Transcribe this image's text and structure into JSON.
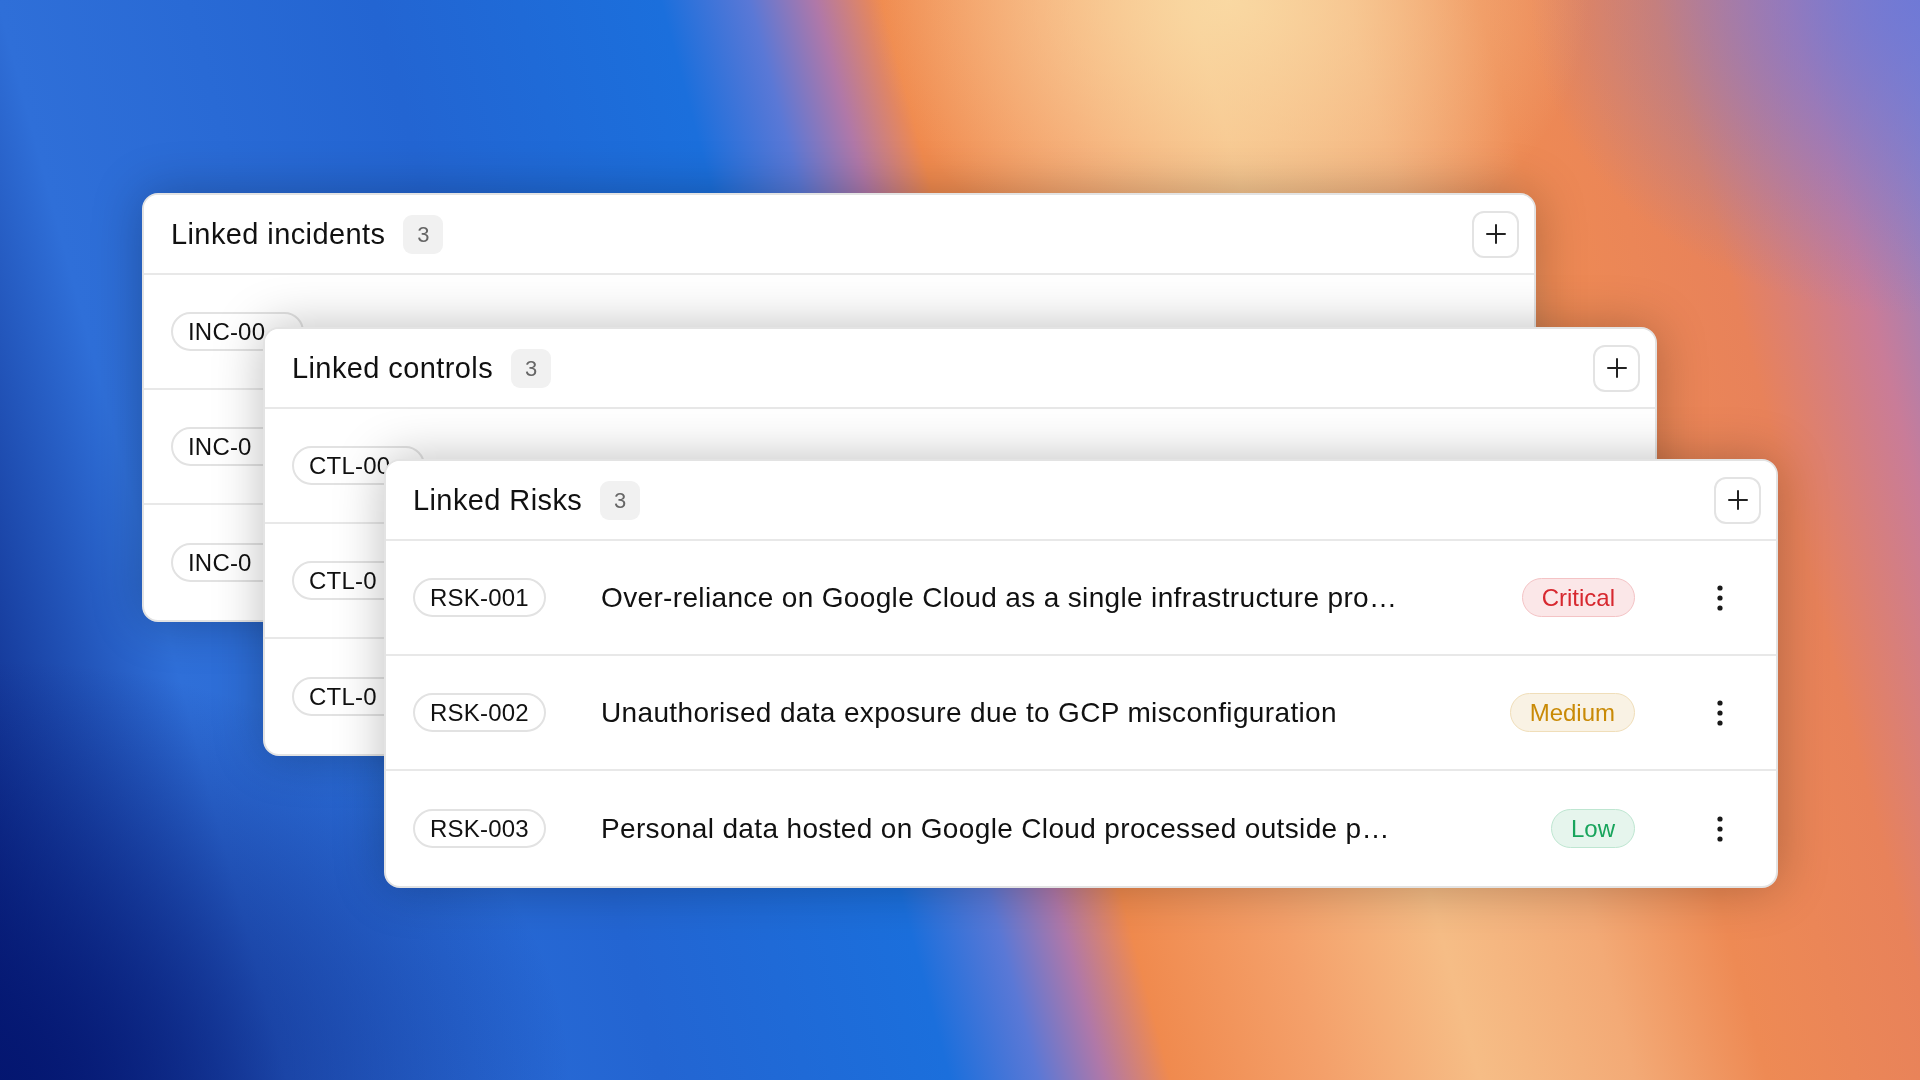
{
  "panels": [
    {
      "title": "Linked incidents",
      "count": "3",
      "rows": [
        {
          "id": "INC-00"
        },
        {
          "id": "INC-0"
        },
        {
          "id": "INC-0"
        }
      ]
    },
    {
      "title": "Linked controls",
      "count": "3",
      "rows": [
        {
          "id": "CTL-00"
        },
        {
          "id": "CTL-0"
        },
        {
          "id": "CTL-0"
        }
      ]
    },
    {
      "title": "Linked Risks",
      "count": "3",
      "rows": [
        {
          "id": "RSK-001",
          "description": "Over-reliance on Google Cloud as a single infrastructure pro…",
          "severity": {
            "label": "Critical",
            "color": "#d7282f"
          },
          "menu": true
        },
        {
          "id": "RSK-002",
          "description": "Unauthorised data exposure due to GCP misconfiguration",
          "severity": {
            "label": "Medium",
            "color": "#c98a06"
          },
          "menu": true
        },
        {
          "id": "RSK-003",
          "description": "Personal data hosted on Google Cloud processed outside p…",
          "severity": {
            "label": "Low",
            "color": "#18a45c"
          },
          "menu": true
        }
      ]
    }
  ]
}
